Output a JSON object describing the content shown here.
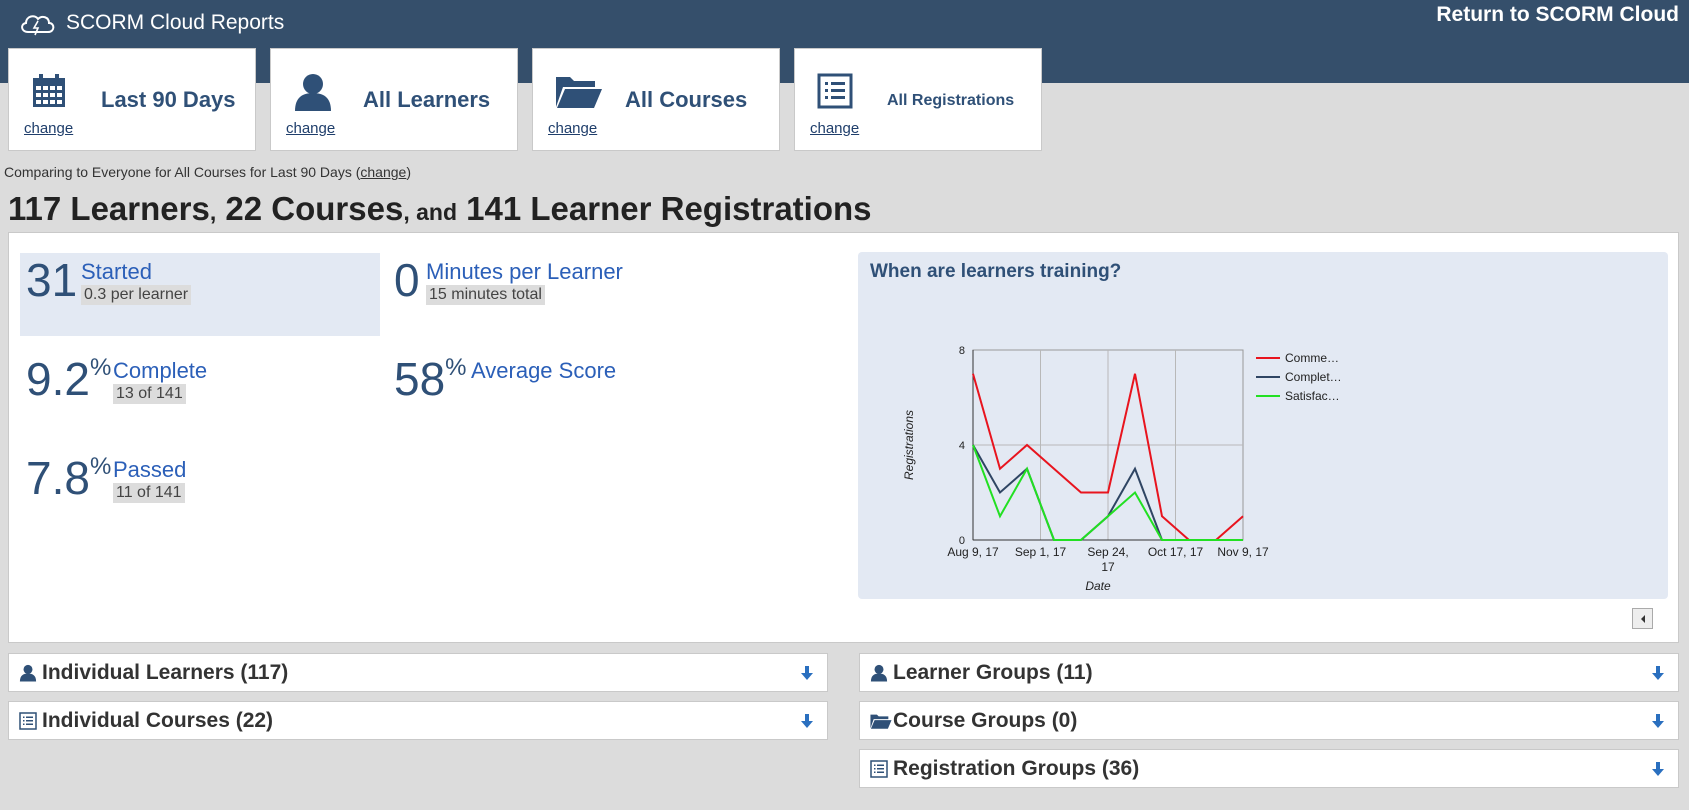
{
  "header": {
    "app_title": "SCORM Cloud Reports",
    "return_link": "Return to SCORM Cloud"
  },
  "filters": [
    {
      "icon": "calendar-icon",
      "label": "Last 90 Days",
      "change": "change"
    },
    {
      "icon": "person-icon",
      "label": "All Learners",
      "change": "change"
    },
    {
      "icon": "folder-icon",
      "label": "All Courses",
      "change": "change"
    },
    {
      "icon": "list-icon",
      "label": "All Registrations",
      "change": "change"
    }
  ],
  "comparison": {
    "text": "Comparing to Everyone for All Courses for Last 90 Days (",
    "link": "change",
    "close": ")"
  },
  "headline": {
    "learners": "117 Learners",
    "sep1": ",",
    "courses": "22 Courses",
    "sep2": ", and",
    "registrations": "141 Learner Registrations"
  },
  "stats": {
    "started": {
      "value": "31",
      "label": "Started",
      "sub": "0.3 per learner"
    },
    "minutes": {
      "value": "0",
      "label": "Minutes per Learner",
      "sub": "15 minutes total"
    },
    "complete": {
      "value": "9.2",
      "unit": "%",
      "label": "Complete",
      "sub": "13 of 141"
    },
    "score": {
      "value": "58",
      "unit": "%",
      "label": "Average Score"
    },
    "passed": {
      "value": "7.8",
      "unit": "%",
      "label": "Passed",
      "sub": "11 of 141"
    }
  },
  "chart_title": "When are learners training?",
  "chart_data": {
    "type": "line",
    "title": "",
    "xlabel": "Date",
    "ylabel": "Registrations",
    "ylim": [
      0,
      8
    ],
    "yticks": [
      "0",
      "4",
      "8"
    ],
    "xticks": [
      {
        "label": [
          "Aug 9, 17"
        ],
        "pos": 0
      },
      {
        "label": [
          "Sep 1, 17"
        ],
        "pos": 1
      },
      {
        "label": [
          "Sep 24,",
          "17"
        ],
        "pos": 2
      },
      {
        "label": [
          "Oct 17, 17"
        ],
        "pos": 3
      },
      {
        "label": [
          "Nov 9, 17"
        ],
        "pos": 4
      }
    ],
    "grid": true,
    "legend_position": "right",
    "points_per_interval": 5,
    "series": [
      {
        "name": "Comme…",
        "color": "#e8141e",
        "values": [
          7,
          3,
          4,
          3,
          2,
          2,
          7,
          1,
          0,
          0,
          1
        ]
      },
      {
        "name": "Complet…",
        "color": "#2f4563",
        "values": [
          4,
          2,
          3,
          0,
          0,
          1,
          3,
          0,
          0,
          0,
          0
        ]
      },
      {
        "name": "Satisfac…",
        "color": "#22e022",
        "values": [
          4,
          1,
          3,
          0,
          0,
          1,
          2,
          0,
          0,
          0,
          0
        ]
      }
    ],
    "x_index": [
      0,
      0.4,
      0.8,
      1.2,
      1.6,
      2.0,
      2.4,
      2.8,
      3.2,
      3.6,
      4.0
    ]
  },
  "sections": [
    {
      "icon": "person-icon",
      "title": "Individual Learners (117)"
    },
    {
      "icon": "list-icon",
      "title": "Individual Courses (22)"
    },
    {
      "icon": "person-icon",
      "title": "Learner Groups (11)"
    },
    {
      "icon": "folder-icon",
      "title": "Course Groups (0)"
    },
    {
      "icon": "list-icon",
      "title": "Registration Groups (36)"
    }
  ]
}
